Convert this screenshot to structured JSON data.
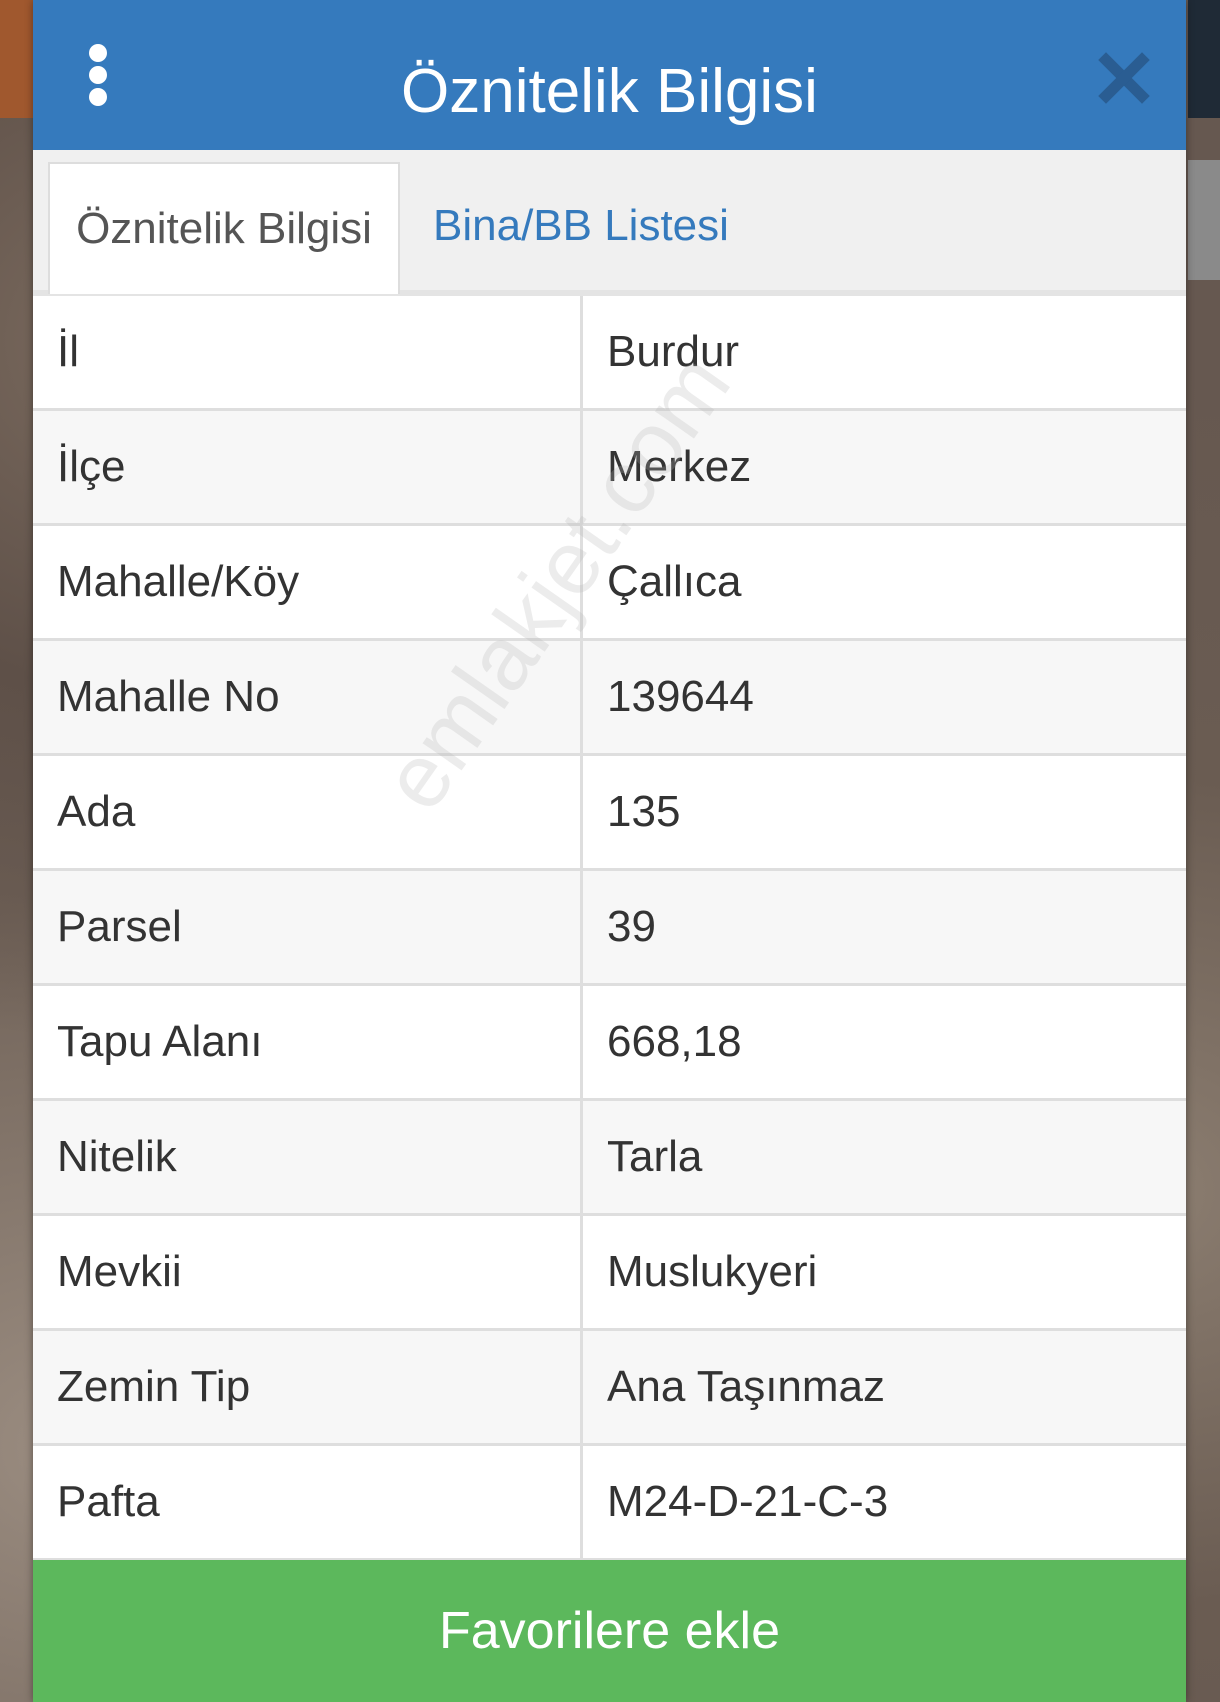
{
  "dialog": {
    "title": "Öznitelik Bilgisi"
  },
  "tabs": [
    {
      "label": "Öznitelik Bilgisi",
      "active": true
    },
    {
      "label": "Bina/BB Listesi",
      "active": false
    }
  ],
  "attributes": [
    {
      "key": "İl",
      "value": "Burdur"
    },
    {
      "key": "İlçe",
      "value": "Merkez"
    },
    {
      "key": "Mahalle/Köy",
      "value": "Çallıca"
    },
    {
      "key": "Mahalle No",
      "value": "139644"
    },
    {
      "key": "Ada",
      "value": "135"
    },
    {
      "key": "Parsel",
      "value": "39"
    },
    {
      "key": "Tapu Alanı",
      "value": "668,18"
    },
    {
      "key": "Nitelik",
      "value": "Tarla"
    },
    {
      "key": "Mevkii",
      "value": "Muslukyeri"
    },
    {
      "key": "Zemin Tip",
      "value": "Ana Taşınmaz"
    },
    {
      "key": "Pafta",
      "value": "M24-D-21-C-3"
    }
  ],
  "watermark": "emlakjet.com",
  "footer": {
    "favorite_label": "Favorilere ekle"
  },
  "icons": {
    "menu": "more-vertical-icon",
    "close": "close-icon"
  },
  "colors": {
    "header": "#357abd",
    "tab_link": "#357abd",
    "favorite_button": "#5cb85c"
  }
}
